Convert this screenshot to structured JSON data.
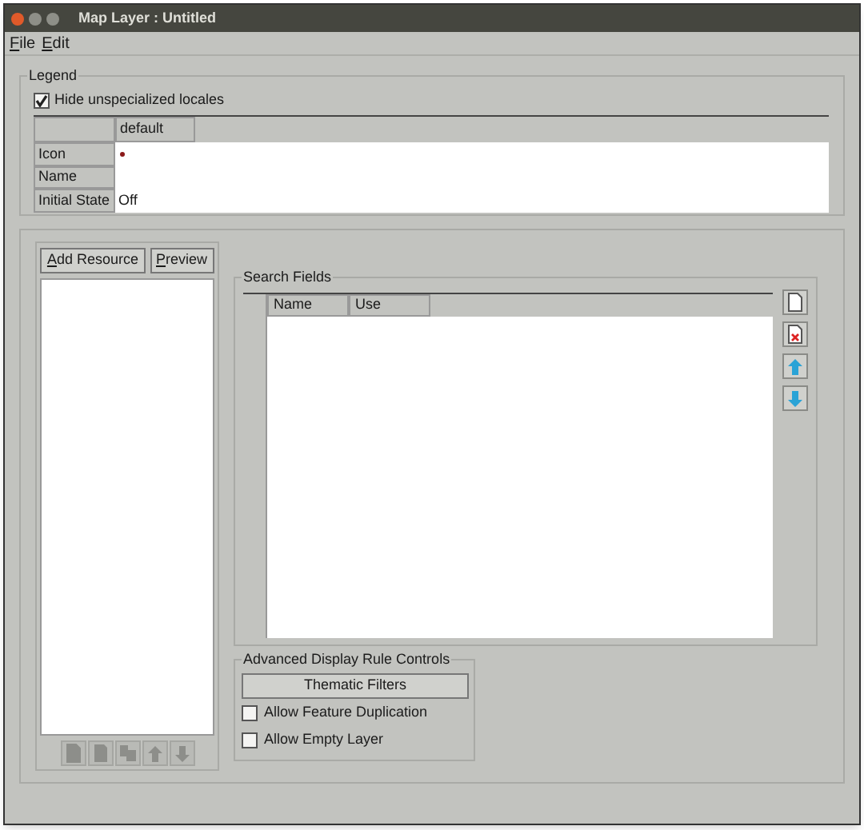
{
  "window": {
    "title": "Map Layer : Untitled"
  },
  "menu": [
    {
      "label": "File",
      "mnemonic": true
    },
    {
      "label": "Edit",
      "mnemonic": true
    }
  ],
  "legend": {
    "title": "Legend",
    "hide_unspecialized": {
      "label": "Hide unspecialized locales",
      "checked": true
    },
    "column": "default",
    "rows": [
      {
        "label": "Icon",
        "kind": "dot",
        "color": "#8b1a1a"
      },
      {
        "label": "Name",
        "kind": "text"
      },
      {
        "label": "Initial State",
        "kind": "text",
        "value": "Off"
      }
    ]
  },
  "resources": {
    "buttons": [
      {
        "label": "Add Resource",
        "mnemonic": true
      },
      {
        "label": "Preview",
        "mnemonic": true
      }
    ],
    "tools": [
      {
        "kind": "new",
        "disabled": true
      },
      {
        "kind": "copy",
        "disabled": true
      },
      {
        "kind": "duplicate",
        "disabled": true
      },
      {
        "kind": "up",
        "disabled": true
      },
      {
        "kind": "down",
        "disabled": true
      }
    ]
  },
  "search_fields": {
    "title": "Search Fields",
    "columns": [
      "Name",
      "Use"
    ],
    "tools": [
      {
        "kind": "new",
        "disabled": false
      },
      {
        "kind": "delete",
        "disabled": false
      },
      {
        "kind": "up",
        "disabled": false
      },
      {
        "kind": "down",
        "disabled": false
      }
    ]
  },
  "advanced": {
    "title": "Advanced Display Rule Controls",
    "button": "Thematic Filters",
    "options": [
      {
        "label": "Allow Feature Duplication",
        "checked": false
      },
      {
        "label": "Allow Empty Layer",
        "checked": false
      }
    ]
  }
}
